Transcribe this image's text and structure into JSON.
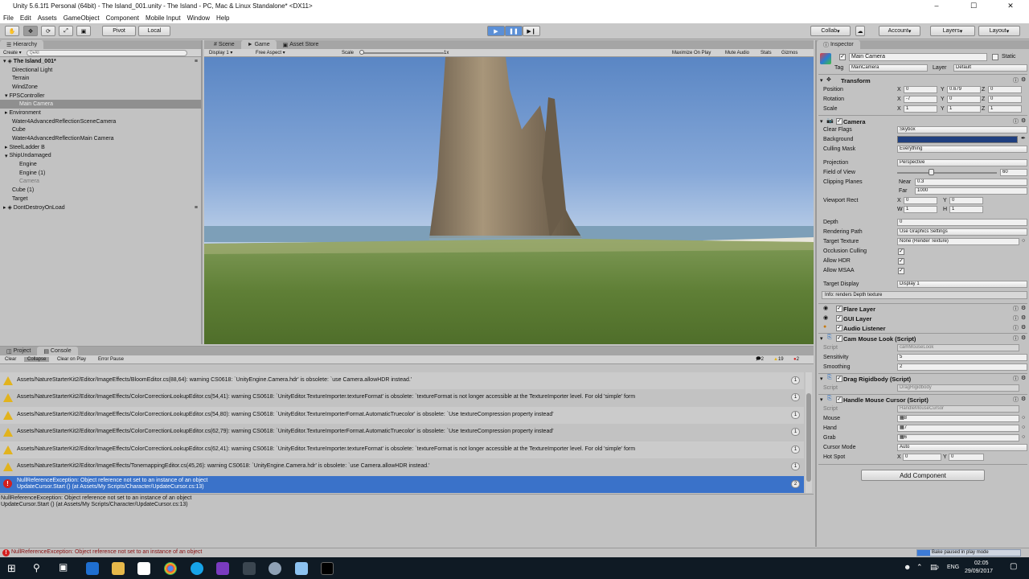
{
  "window": {
    "title": "Unity 5.6.1f1 Personal (64bit) - The Island_001.unity - The Island - PC, Mac & Linux Standalone* <DX11>"
  },
  "menu": [
    "File",
    "Edit",
    "Assets",
    "GameObject",
    "Component",
    "Mobile Input",
    "Window",
    "Help"
  ],
  "toolbar": {
    "pivot": "Pivot",
    "local": "Local",
    "collab": "Collab",
    "account": "Account",
    "layers": "Layers",
    "layout": "Layout"
  },
  "hierarchy": {
    "tab": "Hierarchy",
    "create": "Create",
    "search_placeholder": "Q▾All",
    "scene": "The Island_001*",
    "items": [
      {
        "label": "Directional Light",
        "indent": 1,
        "arrow": false,
        "sel": false,
        "dim": false
      },
      {
        "label": "Terrain",
        "indent": 1,
        "arrow": false,
        "sel": false,
        "dim": false
      },
      {
        "label": "WindZone",
        "indent": 1,
        "arrow": false,
        "sel": false,
        "dim": false
      },
      {
        "label": "FPSController",
        "indent": 1,
        "arrow": true,
        "open": true,
        "sel": false,
        "dim": false
      },
      {
        "label": "Main Camera",
        "indent": 2,
        "arrow": false,
        "sel": true,
        "dim": false
      },
      {
        "label": "Environment",
        "indent": 1,
        "arrow": true,
        "open": false,
        "sel": false,
        "dim": false
      },
      {
        "label": "Water4AdvancedReflectionSceneCamera",
        "indent": 1,
        "arrow": false,
        "sel": false,
        "dim": false
      },
      {
        "label": "Cube",
        "indent": 1,
        "arrow": false,
        "sel": false,
        "dim": false
      },
      {
        "label": "Water4AdvancedReflectionMain Camera",
        "indent": 1,
        "arrow": false,
        "sel": false,
        "dim": false
      },
      {
        "label": "SteelLadder B",
        "indent": 1,
        "arrow": true,
        "open": false,
        "sel": false,
        "dim": false
      },
      {
        "label": "ShipUndamaged",
        "indent": 1,
        "arrow": true,
        "open": true,
        "sel": false,
        "dim": false
      },
      {
        "label": "Engine",
        "indent": 2,
        "arrow": false,
        "sel": false,
        "dim": false
      },
      {
        "label": "Engine (1)",
        "indent": 2,
        "arrow": false,
        "sel": false,
        "dim": false
      },
      {
        "label": "Camera",
        "indent": 2,
        "arrow": false,
        "sel": false,
        "dim": true
      },
      {
        "label": "Cube (1)",
        "indent": 1,
        "arrow": false,
        "sel": false,
        "dim": false
      },
      {
        "label": "Target",
        "indent": 1,
        "arrow": false,
        "sel": false,
        "dim": false
      }
    ],
    "ddol": "DontDestroyOnLoad"
  },
  "game": {
    "tabs": [
      "Scene",
      "Game",
      "Asset Store"
    ],
    "display": "Display 1",
    "aspect": "Free Aspect",
    "scale_label": "Scale",
    "scale_value": "1x",
    "toggles": [
      "Maximize On Play",
      "Mute Audio",
      "Stats",
      "Gizmos"
    ]
  },
  "inspector": {
    "tab": "Inspector",
    "object_name": "Main Camera",
    "static": "Static",
    "tag_label": "Tag",
    "tag": "MainCamera",
    "layer_label": "Layer",
    "layer": "Default",
    "transform": {
      "title": "Transform",
      "position": "Position",
      "rotation": "Rotation",
      "scale": "Scale",
      "pos": [
        "0",
        "0.679",
        "0"
      ],
      "rot": [
        "-7",
        "0",
        "0"
      ],
      "scl": [
        "1",
        "1",
        "1"
      ]
    },
    "camera": {
      "title": "Camera",
      "clear_flags": "Clear Flags",
      "clear_flags_v": "Skybox",
      "background": "Background",
      "background_color": "#1f3f7f",
      "culling": "Culling Mask",
      "culling_v": "Everything",
      "projection": "Projection",
      "projection_v": "Perspective",
      "fov": "Field of View",
      "fov_v": "60",
      "fov_fraction": 0.34,
      "clipping": "Clipping Planes",
      "near": "Near",
      "near_v": "0.3",
      "far": "Far",
      "far_v": "1000",
      "viewport": "Viewport Rect",
      "vr": [
        "0",
        "0",
        "1",
        "1"
      ],
      "depth": "Depth",
      "depth_v": "0",
      "rendering": "Rendering Path",
      "rendering_v": "Use Graphics Settings",
      "target_tex": "Target Texture",
      "target_tex_v": "None (Render Texture)",
      "occlusion": "Occlusion Culling",
      "hdr": "Allow HDR",
      "msaa": "Allow MSAA",
      "target_display": "Target Display",
      "target_display_v": "Display 1",
      "info": "Info: renders Depth texture"
    },
    "flare": "Flare Layer",
    "gui": "GUI Layer",
    "audio": "Audio Listener",
    "cam_mouse": {
      "title": "Cam Mouse Look (Script)",
      "script": "Script",
      "script_v": "camMouseLook",
      "sens": "Sensitivity",
      "sens_v": "5",
      "smooth": "Smoothing",
      "smooth_v": "2"
    },
    "drag": {
      "title": "Drag Rigidbody (Script)",
      "script": "Script",
      "script_v": "DragRigidbody"
    },
    "cursor": {
      "title": "Handle Mouse Cursor (Script)",
      "script": "Script",
      "script_v": "HandleMouseCursor",
      "mouse": "Mouse",
      "mouse_v": "8",
      "hand": "Hand",
      "hand_v": "7",
      "grab": "Grab",
      "grab_v": "6",
      "mode": "Cursor Mode",
      "mode_v": "Auto",
      "hotspot": "Hot Spot",
      "hx": "0",
      "hy": "0"
    },
    "add_component": "Add Component"
  },
  "console": {
    "tabs": [
      "Project",
      "Console"
    ],
    "buttons": [
      "Clear",
      "Collapse",
      "Clear on Play",
      "Error Pause"
    ],
    "counts": {
      "info": "2",
      "warn": "19",
      "err": "2"
    },
    "rows": [
      {
        "type": "warn",
        "text": "Assets/NatureStarterKit2/Editor/ImageEffects/BloomEditor.cs(88,64): warning CS0618: `UnityEngine.Camera.hdr' is obsolete: `use Camera.allowHDR instead.'",
        "count": "1"
      },
      {
        "type": "warn",
        "text": "Assets/NatureStarterKit2/Editor/ImageEffects/ColorCorrectionLookupEditor.cs(54,41): warning CS0618: `UnityEditor.TextureImporter.textureFormat' is obsolete: `textureFormat is not longer accessible at the TextureImporter level. For old 'simple' form",
        "count": "1"
      },
      {
        "type": "warn",
        "text": "Assets/NatureStarterKit2/Editor/ImageEffects/ColorCorrectionLookupEditor.cs(54,80): warning CS0618: `UnityEditor.TextureImporterFormat.AutomaticTruecolor' is obsolete: `Use textureCompression property instead'",
        "count": "1"
      },
      {
        "type": "warn",
        "text": "Assets/NatureStarterKit2/Editor/ImageEffects/ColorCorrectionLookupEditor.cs(62,79): warning CS0618: `UnityEditor.TextureImporterFormat.AutomaticTruecolor' is obsolete: `Use textureCompression property instead'",
        "count": "1"
      },
      {
        "type": "warn",
        "text": "Assets/NatureStarterKit2/Editor/ImageEffects/ColorCorrectionLookupEditor.cs(62,41): warning CS0618: `UnityEditor.TextureImporter.textureFormat' is obsolete: `textureFormat is not longer accessible at the TextureImporter level. For old 'simple' form",
        "count": "1"
      },
      {
        "type": "warn",
        "text": "Assets/NatureStarterKit2/Editor/ImageEffects/TonemappingEditor.cs(45,26): warning CS0618: `UnityEngine.Camera.hdr' is obsolete: `use Camera.allowHDR instead.'",
        "count": "1"
      }
    ],
    "error_row": {
      "line1": "NullReferenceException: Object reference not set to an instance of an object",
      "line2": "UpdateCursor.Start () (at Assets/My Scripts/Character/UpdateCursor.cs:13)",
      "count": "2"
    },
    "detail1": "NullReferenceException: Object reference not set to an instance of an object",
    "detail2": "UpdateCursor.Start () (at Assets/My Scripts/Character/UpdateCursor.cs:13)"
  },
  "status": {
    "message": "NullReferenceException: Object reference not set to an instance of an object",
    "bake": "Bake paused in play mode"
  },
  "taskbar": {
    "time": "02:05",
    "date": "29/09/2017",
    "lang": "ENG"
  },
  "colors": {
    "accent": "#3d7bd6",
    "selection": "#3a72c9",
    "play_active": "#5b8fd6",
    "warning": "#e2b31d",
    "error": "#d21f1f"
  }
}
